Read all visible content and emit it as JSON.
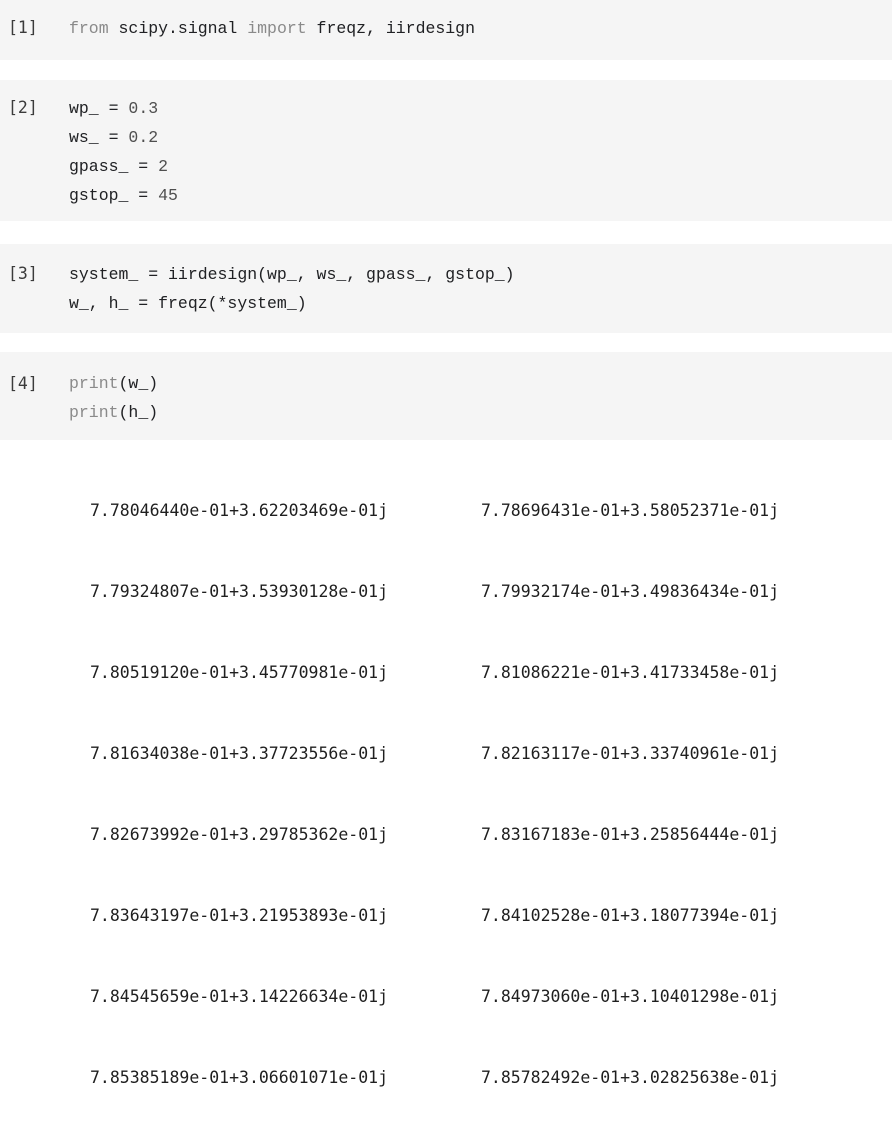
{
  "cells": [
    {
      "count": "[1]",
      "lines": [
        [
          {
            "t": "from",
            "k": "kw"
          },
          {
            "t": " scipy.signal ",
            "k": ""
          },
          {
            "t": "import",
            "k": "kw"
          },
          {
            "t": " freqz, iirdesign",
            "k": ""
          }
        ]
      ]
    },
    {
      "count": "[2]",
      "lines": [
        [
          {
            "t": "wp_ = ",
            "k": ""
          },
          {
            "t": "0.3",
            "k": "num"
          }
        ],
        [
          {
            "t": "ws_ = ",
            "k": ""
          },
          {
            "t": "0.2",
            "k": "num"
          }
        ],
        [
          {
            "t": "gpass_ = ",
            "k": ""
          },
          {
            "t": "2",
            "k": "num"
          }
        ],
        [
          {
            "t": "gstop_ = ",
            "k": ""
          },
          {
            "t": "45",
            "k": "num"
          }
        ]
      ]
    },
    {
      "count": "[3]",
      "lines": [
        [
          {
            "t": "system_ = iirdesign(wp_, ws_, gpass_, gstop_)",
            "k": ""
          }
        ],
        [
          {
            "t": "w_, h_ = freqz(*system_)",
            "k": ""
          }
        ]
      ]
    },
    {
      "count": "[4]",
      "lines": [
        [
          {
            "t": "print",
            "k": "kw"
          },
          {
            "t": "(w_)",
            "k": ""
          }
        ],
        [
          {
            "t": "print",
            "k": "kw"
          },
          {
            "t": "(h_)",
            "k": ""
          }
        ]
      ]
    }
  ],
  "output": [
    [
      "7.78046440e-01+3.62203469e-01j",
      "7.78696431e-01+3.58052371e-01j"
    ],
    [
      "7.79324807e-01+3.53930128e-01j",
      "7.79932174e-01+3.49836434e-01j"
    ],
    [
      "7.80519120e-01+3.45770981e-01j",
      "7.81086221e-01+3.41733458e-01j"
    ],
    [
      "7.81634038e-01+3.37723556e-01j",
      "7.82163117e-01+3.33740961e-01j"
    ],
    [
      "7.82673992e-01+3.29785362e-01j",
      "7.83167183e-01+3.25856444e-01j"
    ],
    [
      "7.83643197e-01+3.21953893e-01j",
      "7.84102528e-01+3.18077394e-01j"
    ],
    [
      "7.84545659e-01+3.14226634e-01j",
      "7.84973060e-01+3.10401298e-01j"
    ],
    [
      "7.85385189e-01+3.06601071e-01j",
      "7.85782492e-01+3.02825638e-01j"
    ]
  ]
}
